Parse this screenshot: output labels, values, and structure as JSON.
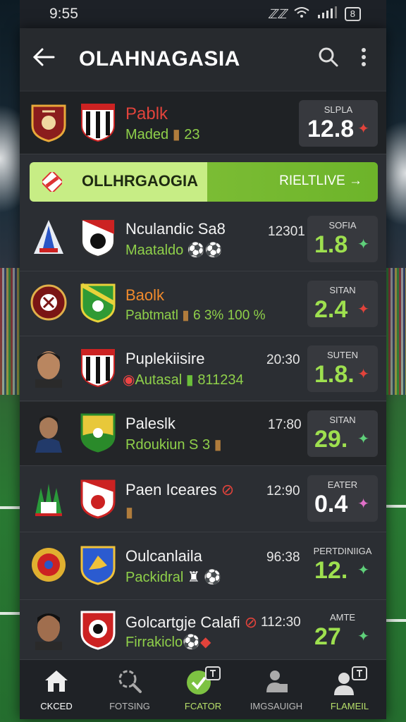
{
  "status": {
    "time": "9:55",
    "signal": "ℤℤ",
    "battery": "8"
  },
  "appbar": {
    "title": "OLAHNAGASIA",
    "back_icon": "back-arrow-icon",
    "search_icon": "search-icon",
    "more_icon": "more-vert-icon"
  },
  "top_match": {
    "team": "Pablk",
    "detail": "Maded",
    "detail_num": "23",
    "odds_label": "SLPLA",
    "odds_value": "12.8",
    "trend": "down"
  },
  "banner": {
    "title": "OLLHRGAOGIA",
    "action": "RIELTLIVE →"
  },
  "matches": [
    {
      "name": "Nculandic Sa8",
      "sub": "Maataldo",
      "time": "12301",
      "odds_label": "SOFIA",
      "odds_value": "1.8",
      "trend": "up"
    },
    {
      "name": "Baolk",
      "sub": "Pabtmatl",
      "sub_extra": "6 3% 100 %",
      "time": "",
      "odds_label": "SITAN",
      "odds_value": "2.4",
      "trend": "down"
    },
    {
      "name": "Puplekiisire",
      "sub": "Autasal",
      "sub_extra": "811234",
      "time": "20:30",
      "odds_label": "SUTEN",
      "odds_value": "1.8.",
      "trend": "down"
    },
    {
      "name": "Paleslk",
      "sub": "Rdoukiun S 3",
      "time": "17:80",
      "odds_label": "SITAN",
      "odds_value": "29.",
      "trend": "up"
    },
    {
      "name": "Paen Iceares",
      "sub": "",
      "time": "12:90",
      "odds_label": "EATER",
      "odds_value": "0.4",
      "trend": "up"
    },
    {
      "name": "Oulcanlaila",
      "sub": "Packidral",
      "time": "96:38",
      "odds_label": "PERTDINIIGA",
      "odds_value": "12.",
      "trend": "up"
    },
    {
      "name": "Golcartgje Calafi",
      "sub": "Firrakiclo",
      "time": "112:30",
      "odds_label": "AMTE",
      "odds_value": "27",
      "trend": "up"
    }
  ],
  "nav": [
    {
      "label": "CKCED",
      "icon": "home-icon"
    },
    {
      "label": "FOTSING",
      "icon": "search-ball-icon"
    },
    {
      "label": "FCATOR",
      "icon": "check-circle-icon"
    },
    {
      "label": "IMGSAUIGH",
      "icon": "people-icon"
    },
    {
      "label": "FLAMEIL",
      "icon": "profile-icon"
    }
  ],
  "colors": {
    "accent_green": "#9ee04f",
    "up": "#5fd07a",
    "down": "#e2433b",
    "pink": "#e070c8"
  }
}
